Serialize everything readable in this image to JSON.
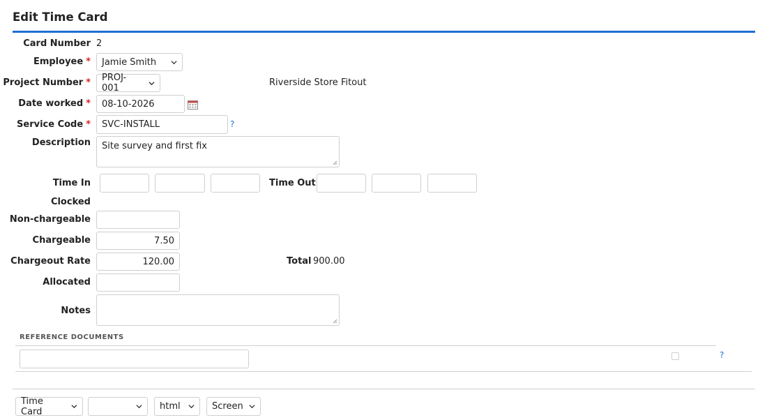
{
  "page": {
    "title": "Edit Time Card"
  },
  "form": {
    "card_number_label": "Card Number",
    "card_number_value": "2",
    "employee_label": "Employee",
    "employee_value": "Jamie Smith",
    "required_mark": "*",
    "project_number_label": "Project Number",
    "project_number_value": "PROJ-001",
    "project_name": "Riverside Store Fitout",
    "date_worked_label": "Date worked",
    "date_worked_value": "08-10-2026",
    "service_code_label": "Service Code",
    "service_code_value": "SVC-INSTALL",
    "help_mark": "?",
    "description_label": "Description",
    "description_value": "Site survey and first fix",
    "time_in_label": "Time In",
    "time_out_label": "Time Out",
    "time_in_values": [
      "",
      "",
      ""
    ],
    "time_out_values": [
      "",
      "",
      ""
    ],
    "clocked_label": "Clocked",
    "non_chargeable_label": "Non-chargeable",
    "non_chargeable_value": "",
    "chargeable_label": "Chargeable",
    "chargeable_value": "7.50",
    "chargeout_rate_label": "Chargeout Rate",
    "chargeout_rate_value": "120.00",
    "total_label": "Total",
    "total_value": "900.00",
    "allocated_label": "Allocated",
    "allocated_value": "",
    "notes_label": "Notes",
    "notes_value": ""
  },
  "reference_documents": {
    "title": "REFERENCE DOCUMENTS",
    "input_value": "",
    "help_mark": "?"
  },
  "footer": {
    "selects": [
      "Time Card",
      "",
      "html",
      "Screen"
    ]
  },
  "colors": {
    "accent": "#1f6fd1",
    "required": "#dd2222"
  },
  "icons": [
    "chevron-down-icon",
    "calendar-icon",
    "resize-grip-icon"
  ]
}
